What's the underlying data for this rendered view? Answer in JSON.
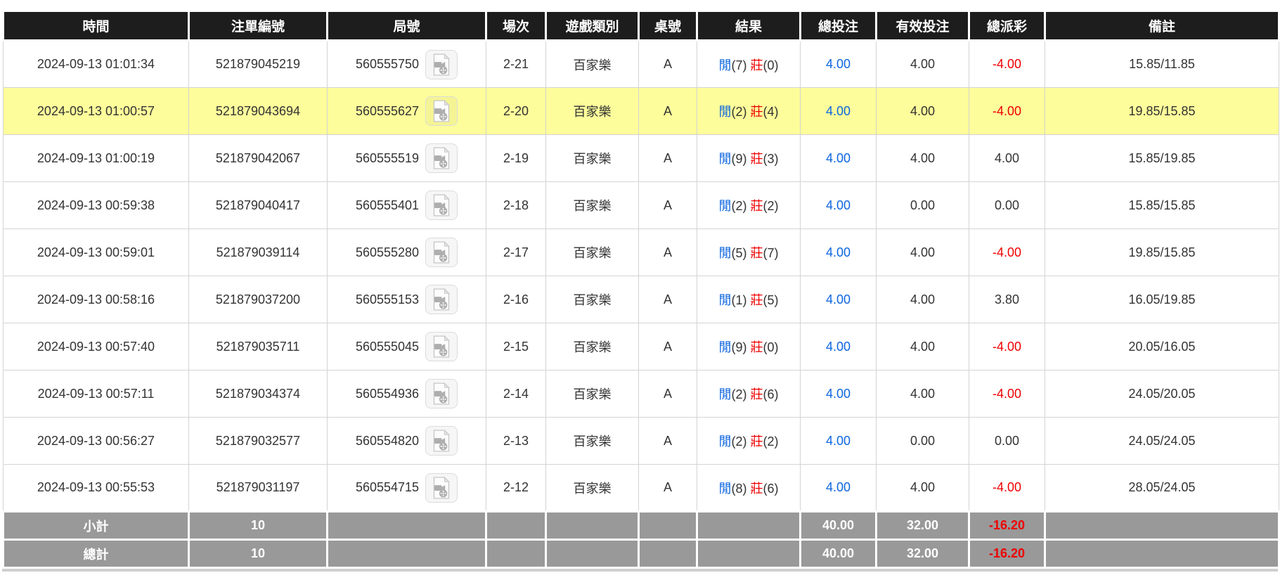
{
  "colors": {
    "header_bg": "#1d1d1d",
    "link_blue": "#0d66e0",
    "negative_red": "#ee0000",
    "row_highlight_yellow": "#fdfd9b",
    "footer_gray": "#999999"
  },
  "table": {
    "columns": [
      "時間",
      "注單編號",
      "局號",
      "場次",
      "遊戲類別",
      "桌號",
      "結果",
      "總投注",
      "有效投注",
      "總派彩",
      "備註"
    ],
    "selected_row_index": 1,
    "video_icon_name": "video-file-icon",
    "rows": [
      {
        "time": "2024-09-13 01:01:34",
        "bet_id": "521879045219",
        "round_id": "560555750",
        "session": "2-21",
        "game_type": "百家樂",
        "table_no": "A",
        "result": {
          "player_label": "閒",
          "player_score": "(7)",
          "banker_label": "莊",
          "banker_score": "(0)"
        },
        "total_bet": "4.00",
        "valid_bet": "4.00",
        "total_payout": "-4.00",
        "remark": "15.85/11.85"
      },
      {
        "time": "2024-09-13 01:00:57",
        "bet_id": "521879043694",
        "round_id": "560555627",
        "session": "2-20",
        "game_type": "百家樂",
        "table_no": "A",
        "result": {
          "player_label": "閒",
          "player_score": "(2)",
          "banker_label": "莊",
          "banker_score": "(4)"
        },
        "total_bet": "4.00",
        "valid_bet": "4.00",
        "total_payout": "-4.00",
        "remark": "19.85/15.85"
      },
      {
        "time": "2024-09-13 01:00:19",
        "bet_id": "521879042067",
        "round_id": "560555519",
        "session": "2-19",
        "game_type": "百家樂",
        "table_no": "A",
        "result": {
          "player_label": "閒",
          "player_score": "(9)",
          "banker_label": "莊",
          "banker_score": "(3)"
        },
        "total_bet": "4.00",
        "valid_bet": "4.00",
        "total_payout": "4.00",
        "remark": "15.85/19.85"
      },
      {
        "time": "2024-09-13 00:59:38",
        "bet_id": "521879040417",
        "round_id": "560555401",
        "session": "2-18",
        "game_type": "百家樂",
        "table_no": "A",
        "result": {
          "player_label": "閒",
          "player_score": "(2)",
          "banker_label": "莊",
          "banker_score": "(2)"
        },
        "total_bet": "4.00",
        "valid_bet": "0.00",
        "total_payout": "0.00",
        "remark": "15.85/15.85"
      },
      {
        "time": "2024-09-13 00:59:01",
        "bet_id": "521879039114",
        "round_id": "560555280",
        "session": "2-17",
        "game_type": "百家樂",
        "table_no": "A",
        "result": {
          "player_label": "閒",
          "player_score": "(5)",
          "banker_label": "莊",
          "banker_score": "(7)"
        },
        "total_bet": "4.00",
        "valid_bet": "4.00",
        "total_payout": "-4.00",
        "remark": "19.85/15.85"
      },
      {
        "time": "2024-09-13 00:58:16",
        "bet_id": "521879037200",
        "round_id": "560555153",
        "session": "2-16",
        "game_type": "百家樂",
        "table_no": "A",
        "result": {
          "player_label": "閒",
          "player_score": "(1)",
          "banker_label": "莊",
          "banker_score": "(5)"
        },
        "total_bet": "4.00",
        "valid_bet": "4.00",
        "total_payout": "3.80",
        "remark": "16.05/19.85"
      },
      {
        "time": "2024-09-13 00:57:40",
        "bet_id": "521879035711",
        "round_id": "560555045",
        "session": "2-15",
        "game_type": "百家樂",
        "table_no": "A",
        "result": {
          "player_label": "閒",
          "player_score": "(9)",
          "banker_label": "莊",
          "banker_score": "(0)"
        },
        "total_bet": "4.00",
        "valid_bet": "4.00",
        "total_payout": "-4.00",
        "remark": "20.05/16.05"
      },
      {
        "time": "2024-09-13 00:57:11",
        "bet_id": "521879034374",
        "round_id": "560554936",
        "session": "2-14",
        "game_type": "百家樂",
        "table_no": "A",
        "result": {
          "player_label": "閒",
          "player_score": "(2)",
          "banker_label": "莊",
          "banker_score": "(6)"
        },
        "total_bet": "4.00",
        "valid_bet": "4.00",
        "total_payout": "-4.00",
        "remark": "24.05/20.05"
      },
      {
        "time": "2024-09-13 00:56:27",
        "bet_id": "521879032577",
        "round_id": "560554820",
        "session": "2-13",
        "game_type": "百家樂",
        "table_no": "A",
        "result": {
          "player_label": "閒",
          "player_score": "(2)",
          "banker_label": "莊",
          "banker_score": "(2)"
        },
        "total_bet": "4.00",
        "valid_bet": "0.00",
        "total_payout": "0.00",
        "remark": "24.05/24.05"
      },
      {
        "time": "2024-09-13 00:55:53",
        "bet_id": "521879031197",
        "round_id": "560554715",
        "session": "2-12",
        "game_type": "百家樂",
        "table_no": "A",
        "result": {
          "player_label": "閒",
          "player_score": "(8)",
          "banker_label": "莊",
          "banker_score": "(6)"
        },
        "total_bet": "4.00",
        "valid_bet": "4.00",
        "total_payout": "-4.00",
        "remark": "28.05/24.05"
      }
    ],
    "footer": [
      {
        "label": "小計",
        "count": "10",
        "total_bet": "40.00",
        "valid_bet": "32.00",
        "total_payout": "-16.20"
      },
      {
        "label": "總計",
        "count": "10",
        "total_bet": "40.00",
        "valid_bet": "32.00",
        "total_payout": "-16.20"
      }
    ]
  }
}
